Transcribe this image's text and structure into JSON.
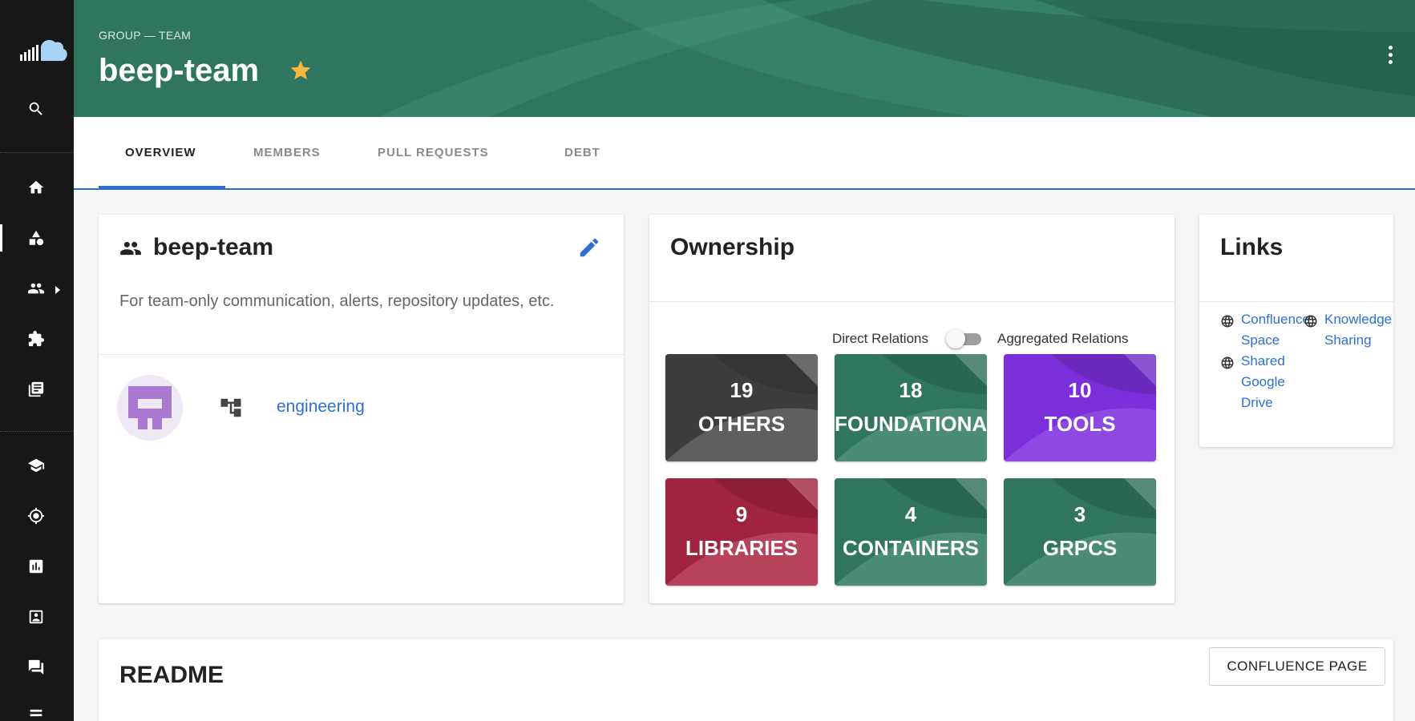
{
  "sidebar": {
    "logo_icon": "cloud-logo",
    "items": [
      {
        "icon": "search-icon"
      },
      {
        "icon": "home-icon"
      },
      {
        "icon": "catalog-shapes-icon",
        "active": true
      },
      {
        "icon": "groups-icon"
      },
      {
        "icon": "extension-puzzle-icon"
      },
      {
        "icon": "docs-library-icon"
      },
      {
        "icon": "school-icon"
      },
      {
        "icon": "radar-icon"
      },
      {
        "icon": "analytics-icon"
      },
      {
        "icon": "portrait-icon"
      },
      {
        "icon": "forum-icon"
      }
    ]
  },
  "header": {
    "breadcrumb": "GROUP — TEAM",
    "title": "beep-team",
    "star_color": "#f6b73c",
    "background_color": "#2f7560"
  },
  "tabs": [
    {
      "label": "OVERVIEW",
      "active": true
    },
    {
      "label": "MEMBERS"
    },
    {
      "label": "PULL REQUESTS"
    },
    {
      "label": "DEBT"
    }
  ],
  "about": {
    "title": "beep-team",
    "description": "For team-only communication, alerts, repository updates, etc.",
    "parent_group": "engineering"
  },
  "ownership": {
    "title": "Ownership",
    "toggle_left_label": "Direct Relations",
    "toggle_right_label": "Aggregated Relations",
    "tiles": [
      {
        "count": "19",
        "label": "OTHERS",
        "color": "#3d3d3d"
      },
      {
        "count": "18",
        "label": "FOUNDATIONAL_SERVICES",
        "color": "#2f7560"
      },
      {
        "count": "10",
        "label": "TOOLS",
        "color": "#7a2fd8"
      },
      {
        "count": "9",
        "label": "LIBRARIES",
        "color": "#a0233f"
      },
      {
        "count": "4",
        "label": "CONTAINERS",
        "color": "#2f7560"
      },
      {
        "count": "3",
        "label": "GRPCS",
        "color": "#2f7560"
      }
    ]
  },
  "links": {
    "title": "Links",
    "items": [
      {
        "label": "Confluence Space"
      },
      {
        "label": "Knowledge Sharing"
      },
      {
        "label": "Shared Google Drive"
      }
    ]
  },
  "readme": {
    "title": "README",
    "button_label": "CONFLUENCE PAGE"
  }
}
